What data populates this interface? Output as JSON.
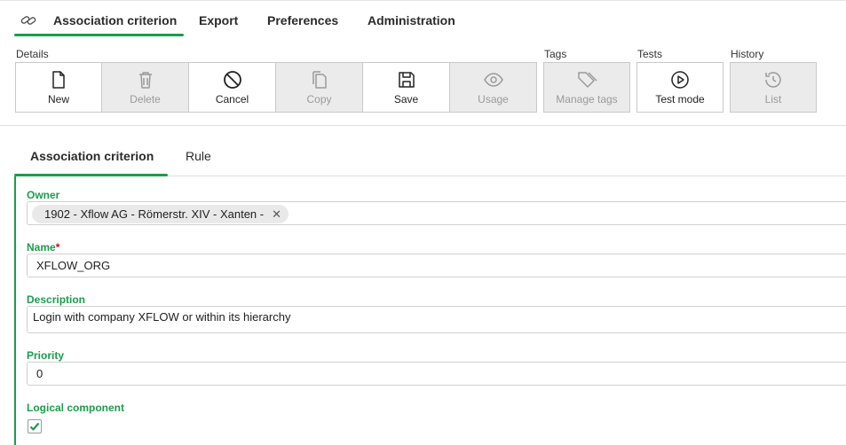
{
  "nav": {
    "tabs": [
      "Association criterion",
      "Export",
      "Preferences",
      "Administration"
    ]
  },
  "toolbar": {
    "groups": {
      "details": "Details",
      "tags": "Tags",
      "tests": "Tests",
      "history": "History"
    },
    "buttons": {
      "new": "New",
      "delete": "Delete",
      "cancel": "Cancel",
      "copy": "Copy",
      "save": "Save",
      "usage": "Usage",
      "manage_tags": "Manage tags",
      "test_mode": "Test mode",
      "list": "List"
    }
  },
  "subtabs": [
    "Association criterion",
    "Rule"
  ],
  "form": {
    "owner": {
      "label": "Owner",
      "chip": "1902 - Xflow AG - Römerstr. XIV - Xanten -",
      "remove_glyph": "✕"
    },
    "name": {
      "label": "Name",
      "required_mark": "*",
      "value": "XFLOW_ORG"
    },
    "description": {
      "label": "Description",
      "value": "Login with company XFLOW or within its hierarchy"
    },
    "priority": {
      "label": "Priority",
      "value": "0"
    },
    "logical_component": {
      "label": "Logical component",
      "checked": true
    }
  },
  "colors": {
    "accent": "#1a9d4b",
    "required": "#d0021b",
    "disabled_bg": "#ebebeb"
  }
}
